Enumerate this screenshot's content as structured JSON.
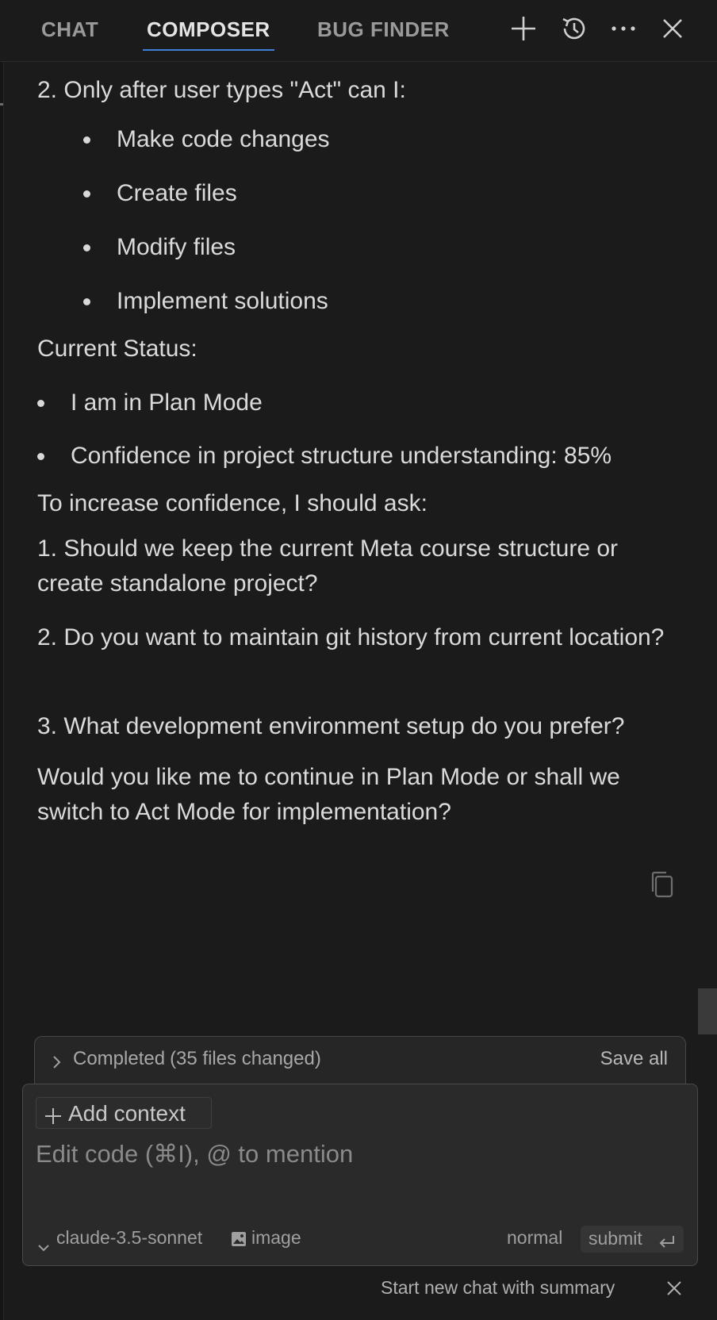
{
  "header": {
    "tabs": [
      {
        "label": "CHAT",
        "active": false
      },
      {
        "label": "COMPOSER",
        "active": true
      },
      {
        "label": "BUG FINDER",
        "active": false
      }
    ],
    "icons": [
      "plus-icon",
      "history-icon",
      "more-icon",
      "close-icon"
    ],
    "accent_color": "#3f7fd8"
  },
  "message": {
    "step2_heading": "2. Only after user types \"Act\" can I:",
    "step2_items": [
      "Make code changes",
      "Create files",
      "Modify files",
      "Implement solutions"
    ],
    "status_heading": "Current Status:",
    "status_items": [
      "I am in Plan Mode",
      "Confidence in project structure understanding: 85%"
    ],
    "ask_heading": "To increase confidence, I should ask:",
    "questions": [
      "1. Should we keep the current Meta course structure or create standalone project?",
      "2. Do you want to maintain git history from current location?",
      "3. What development environment setup do you prefer?"
    ],
    "closing": "Would you like me to continue in Plan Mode or shall we switch to Act Mode for implementation?"
  },
  "completed_bar": {
    "status": "Completed",
    "count": "(35 files changed)",
    "save_label": "Save all"
  },
  "composer": {
    "add_context_label": "Add context",
    "input_value": "",
    "input_placeholder": "Edit code (⌘I), @ to mention",
    "model": "claude-3.5-sonnet",
    "image_label": "image",
    "mode": "normal",
    "submit_label": "submit"
  },
  "footer": {
    "new_chat_label": "Start new chat with summary"
  }
}
